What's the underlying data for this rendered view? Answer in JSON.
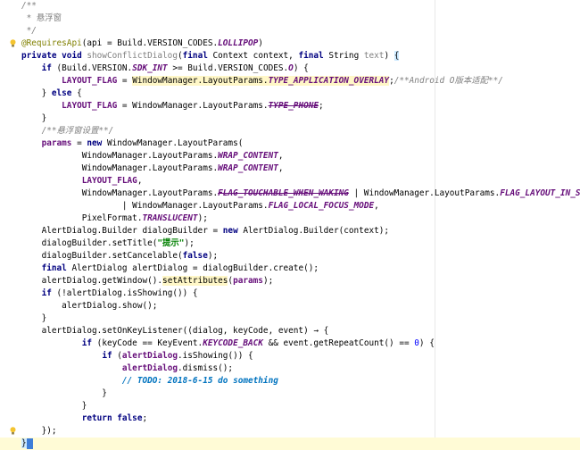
{
  "lines": [
    {
      "tokens": [
        {
          "t": "/**",
          "c": "cm"
        }
      ]
    },
    {
      "tokens": [
        {
          "t": " * 悬浮窗",
          "c": "cmz"
        }
      ]
    },
    {
      "tokens": [
        {
          "t": " */",
          "c": "cm"
        }
      ]
    },
    {
      "tokens": [
        {
          "t": "@RequiresApi",
          "c": "ann"
        },
        {
          "t": "(api = Build.VERSION_CODES.",
          "c": ""
        },
        {
          "t": "LOLLIPOP",
          "c": "fld"
        },
        {
          "t": ")",
          "c": ""
        }
      ]
    },
    {
      "tokens": [
        {
          "t": "private void ",
          "c": "kw"
        },
        {
          "t": "showConflictDialog",
          "c": "unused"
        },
        {
          "t": "(",
          "c": ""
        },
        {
          "t": "final ",
          "c": "kw"
        },
        {
          "t": "Context context, ",
          "c": ""
        },
        {
          "t": "final ",
          "c": "kw"
        },
        {
          "t": "String ",
          "c": ""
        },
        {
          "t": "text",
          "c": "unused"
        },
        {
          "t": ") ",
          "c": ""
        },
        {
          "t": "{",
          "c": "brace-match"
        }
      ]
    },
    {
      "tokens": [
        {
          "t": "    ",
          "c": ""
        },
        {
          "t": "if ",
          "c": "kw"
        },
        {
          "t": "(Build.VERSION.",
          "c": ""
        },
        {
          "t": "SDK_INT",
          "c": "fld"
        },
        {
          "t": " >= Build.VERSION_CODES.",
          "c": ""
        },
        {
          "t": "O",
          "c": "fld"
        },
        {
          "t": ") {",
          "c": ""
        }
      ]
    },
    {
      "tokens": [
        {
          "t": "        ",
          "c": ""
        },
        {
          "t": "LAYOUT_FLAG",
          "c": "fldp"
        },
        {
          "t": " = ",
          "c": ""
        },
        {
          "t": "WindowManager.LayoutParams.",
          "c": "hl"
        },
        {
          "t": "TYPE_APPLICATION_OVERLAY",
          "c": "fld hl"
        },
        {
          "t": ";",
          "c": ""
        },
        {
          "t": "/**Android O版本适配**/",
          "c": "cm"
        }
      ]
    },
    {
      "tokens": [
        {
          "t": "    } ",
          "c": ""
        },
        {
          "t": "else ",
          "c": "kw"
        },
        {
          "t": "{",
          "c": ""
        }
      ]
    },
    {
      "tokens": [
        {
          "t": "        ",
          "c": ""
        },
        {
          "t": "LAYOUT_FLAG",
          "c": "fldp"
        },
        {
          "t": " = WindowManager.LayoutParams.",
          "c": ""
        },
        {
          "t": "TYPE_PHONE",
          "c": "fld strike"
        },
        {
          "t": ";",
          "c": ""
        }
      ]
    },
    {
      "tokens": [
        {
          "t": "    }",
          "c": ""
        }
      ]
    },
    {
      "tokens": [
        {
          "t": "    ",
          "c": ""
        },
        {
          "t": "/**悬浮窗设置**/",
          "c": "cm"
        }
      ]
    },
    {
      "tokens": [
        {
          "t": "    ",
          "c": ""
        },
        {
          "t": "params",
          "c": "fldp"
        },
        {
          "t": " = ",
          "c": ""
        },
        {
          "t": "new ",
          "c": "kw"
        },
        {
          "t": "WindowManager.LayoutParams(",
          "c": ""
        }
      ]
    },
    {
      "tokens": [
        {
          "t": "            WindowManager.LayoutParams.",
          "c": ""
        },
        {
          "t": "WRAP_CONTENT",
          "c": "fld"
        },
        {
          "t": ",",
          "c": ""
        }
      ]
    },
    {
      "tokens": [
        {
          "t": "            WindowManager.LayoutParams.",
          "c": ""
        },
        {
          "t": "WRAP_CONTENT",
          "c": "fld"
        },
        {
          "t": ",",
          "c": ""
        }
      ]
    },
    {
      "tokens": [
        {
          "t": "            ",
          "c": ""
        },
        {
          "t": "LAYOUT_FLAG",
          "c": "fldp"
        },
        {
          "t": ",",
          "c": ""
        }
      ]
    },
    {
      "tokens": [
        {
          "t": "            WindowManager.LayoutParams.",
          "c": ""
        },
        {
          "t": "FLAG_TOUCHABLE_WHEN_WAKING",
          "c": "fld strike"
        },
        {
          "t": " | WindowManager.LayoutParams.",
          "c": ""
        },
        {
          "t": "FLAG_LAYOUT_IN_SCREEN",
          "c": "fld"
        }
      ]
    },
    {
      "tokens": [
        {
          "t": "                    | WindowManager.LayoutParams.",
          "c": ""
        },
        {
          "t": "FLAG_LOCAL_FOCUS_MODE",
          "c": "fld"
        },
        {
          "t": ",",
          "c": ""
        }
      ]
    },
    {
      "tokens": [
        {
          "t": "            PixelFormat.",
          "c": ""
        },
        {
          "t": "TRANSLUCENT",
          "c": "fld"
        },
        {
          "t": ");",
          "c": ""
        }
      ]
    },
    {
      "tokens": [
        {
          "t": "    AlertDialog.Builder dialogBuilder = ",
          "c": ""
        },
        {
          "t": "new ",
          "c": "kw"
        },
        {
          "t": "AlertDialog.Builder(context);",
          "c": ""
        }
      ]
    },
    {
      "tokens": [
        {
          "t": "    dialogBuilder.setTitle(",
          "c": ""
        },
        {
          "t": "\"提示\"",
          "c": "str"
        },
        {
          "t": ");",
          "c": ""
        }
      ]
    },
    {
      "tokens": [
        {
          "t": "    dialogBuilder.setCancelable(",
          "c": ""
        },
        {
          "t": "false",
          "c": "kw"
        },
        {
          "t": ");",
          "c": ""
        }
      ]
    },
    {
      "tokens": [
        {
          "t": "    ",
          "c": ""
        },
        {
          "t": "final ",
          "c": "kw"
        },
        {
          "t": "AlertDialog alertDialog = dialogBuilder.create();",
          "c": ""
        }
      ]
    },
    {
      "tokens": [
        {
          "t": "    alertDialog.getWindow().",
          "c": ""
        },
        {
          "t": "setAttributes",
          "c": "hl"
        },
        {
          "t": "(",
          "c": ""
        },
        {
          "t": "params",
          "c": "fldp"
        },
        {
          "t": ");",
          "c": ""
        }
      ]
    },
    {
      "tokens": [
        {
          "t": "    ",
          "c": ""
        },
        {
          "t": "if ",
          "c": "kw"
        },
        {
          "t": "(!alertDialog.isShowing()) {",
          "c": ""
        }
      ]
    },
    {
      "tokens": [
        {
          "t": "        alertDialog.show();",
          "c": ""
        }
      ]
    },
    {
      "tokens": [
        {
          "t": "    }",
          "c": ""
        }
      ]
    },
    {
      "tokens": [
        {
          "t": "    alertDialog.setOnKeyListener((dialog, keyCode, event) → {",
          "c": ""
        }
      ]
    },
    {
      "tokens": [
        {
          "t": "            ",
          "c": ""
        },
        {
          "t": "if ",
          "c": "kw"
        },
        {
          "t": "(keyCode == KeyEvent.",
          "c": ""
        },
        {
          "t": "KEYCODE_BACK",
          "c": "fld"
        },
        {
          "t": " && event.getRepeatCount() == ",
          "c": ""
        },
        {
          "t": "0",
          "c": "num"
        },
        {
          "t": ") {",
          "c": ""
        }
      ]
    },
    {
      "tokens": [
        {
          "t": "                ",
          "c": ""
        },
        {
          "t": "if ",
          "c": "kw"
        },
        {
          "t": "(",
          "c": ""
        },
        {
          "t": "alertDialog",
          "c": "fldp"
        },
        {
          "t": ".isShowing()) {",
          "c": ""
        }
      ]
    },
    {
      "tokens": [
        {
          "t": "                    ",
          "c": ""
        },
        {
          "t": "alertDialog",
          "c": "fldp"
        },
        {
          "t": ".dismiss();",
          "c": ""
        }
      ]
    },
    {
      "tokens": [
        {
          "t": "                    ",
          "c": ""
        },
        {
          "t": "// TODO: 2018-6-15 do something",
          "c": "todo"
        }
      ]
    },
    {
      "tokens": [
        {
          "t": "                }",
          "c": ""
        }
      ]
    },
    {
      "tokens": [
        {
          "t": "            }",
          "c": ""
        }
      ]
    },
    {
      "tokens": [
        {
          "t": "            ",
          "c": ""
        },
        {
          "t": "return false",
          "c": "kw"
        },
        {
          "t": ";",
          "c": ""
        }
      ]
    },
    {
      "tokens": [
        {
          "t": "    });",
          "c": ""
        }
      ]
    },
    {
      "tokens": [
        {
          "t": "}",
          "c": "brace-match"
        }
      ],
      "current": true
    }
  ],
  "icons": {
    "bulb_rows": [
      4,
      35
    ],
    "bulb_color": "#f4c430"
  }
}
